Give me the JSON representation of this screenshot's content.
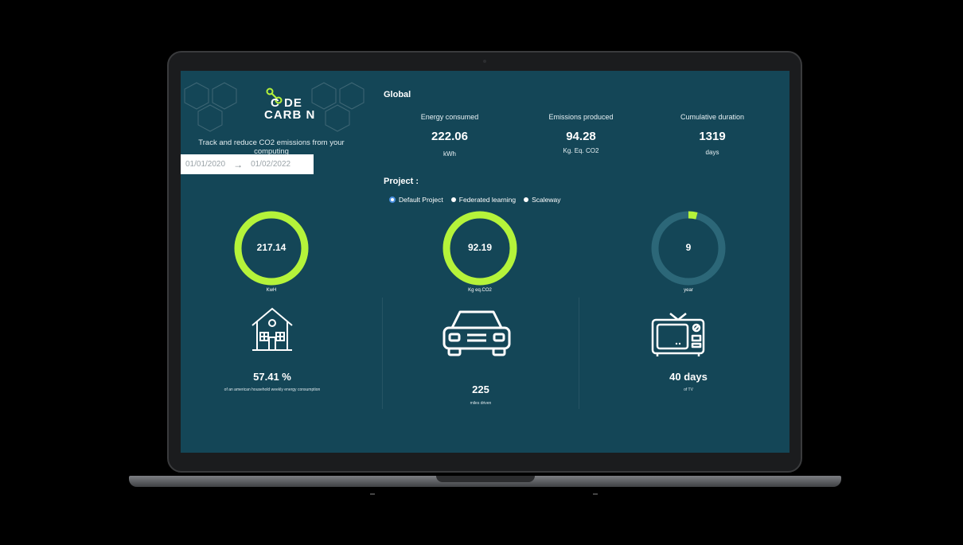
{
  "brand": {
    "logo_line1": "C DE",
    "logo_line2": "CARB N",
    "tagline": "Track and reduce CO2 emissions from your computing",
    "accent_color": "#b5f33a"
  },
  "date_range": {
    "start": "01/01/2020",
    "arrow": "→",
    "end": "01/02/2022"
  },
  "global": {
    "title": "Global",
    "stats": [
      {
        "label": "Energy consumed",
        "value": "222.06",
        "unit": "kWh"
      },
      {
        "label": "Emissions produced",
        "value": "94.28",
        "unit": "Kg. Eq. CO2"
      },
      {
        "label": "Cumulative duration",
        "value": "1319",
        "unit": "days"
      }
    ]
  },
  "project": {
    "title": "Project :",
    "options": [
      "Default Project",
      "Federated learning",
      "Scaleway"
    ],
    "selected": "Default Project"
  },
  "gauges": [
    {
      "value": "217.14",
      "unit": "KwH",
      "fill_fraction": 1.0
    },
    {
      "value": "92.19",
      "unit": "Kg eq.CO2",
      "fill_fraction": 1.0
    },
    {
      "value": "9",
      "unit": "year",
      "fill_fraction": 0.04
    }
  ],
  "equivalents": [
    {
      "icon": "house-icon",
      "value": "57.41 %",
      "caption": "of an american household weekly energy consumption"
    },
    {
      "icon": "car-icon",
      "value": "225",
      "caption": "miles driven"
    },
    {
      "icon": "tv-icon",
      "value": "40 days",
      "caption": "of TV"
    }
  ]
}
